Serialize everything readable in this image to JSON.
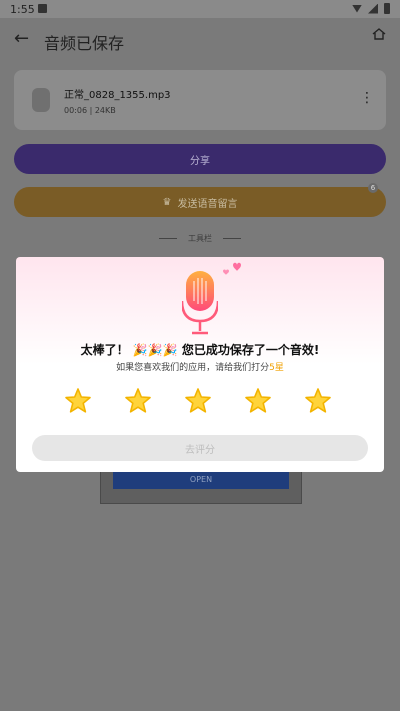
{
  "status": {
    "time": "1:55"
  },
  "header": {
    "title": "音频已保存"
  },
  "file": {
    "name": "正常_0828_1355.mp3",
    "meta": "00:06 | 24KB"
  },
  "buttons": {
    "share": "分享",
    "voice_message": "发送语音留言",
    "badge": "6"
  },
  "toolbox": {
    "label": "工具栏"
  },
  "background": {
    "open_button": "OPEN"
  },
  "dialog": {
    "headline_prefix": "太棒了！",
    "headline_emoji": "🎉🎉🎉",
    "headline_suffix": "您已成功保存了一个音效!",
    "subline_prefix": "如果您喜欢我们的应用，请给我们打分",
    "subline_highlight": "5星",
    "rate_button": "去评分",
    "stars_count": 5
  },
  "colors": {
    "star_fill": "#ffd43a",
    "star_stroke": "#f3b400",
    "mic": "#f06a4a",
    "heart": "#ff6fa0",
    "highlight": "#f0a000"
  }
}
